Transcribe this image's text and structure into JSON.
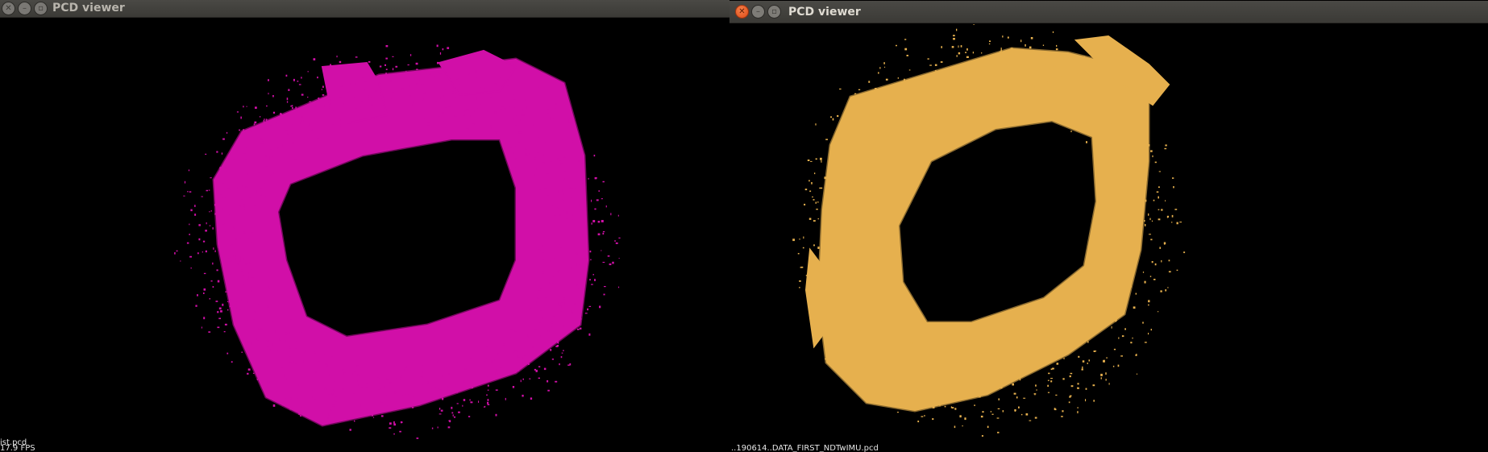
{
  "left_window": {
    "title": "PCD viewer",
    "overlay": {
      "filename": "ist.pcd",
      "fps": "17.9 FPS"
    },
    "point_cloud_color": "#d10fa8",
    "focused": false
  },
  "right_window": {
    "title": "PCD viewer",
    "overlay": {
      "filename": "..190614..DATA_FIRST_NDTwIMU.pcd"
    },
    "point_cloud_color": "#e6b04e",
    "focused": true
  },
  "icons": {
    "close": "close-icon",
    "minimize": "minimize-icon",
    "maximize": "maximize-icon"
  }
}
